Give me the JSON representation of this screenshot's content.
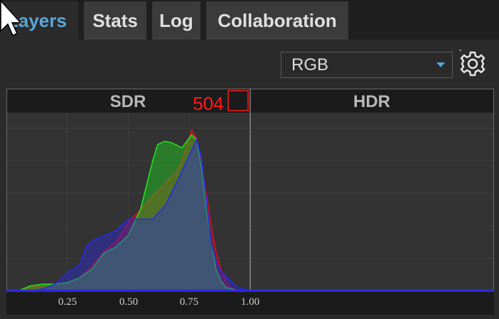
{
  "tabs": [
    {
      "label": "Layers",
      "active": true
    },
    {
      "label": "Stats",
      "active": false
    },
    {
      "label": "Log",
      "active": false
    },
    {
      "label": "Collaboration",
      "active": false
    }
  ],
  "channel_select": {
    "value": "RGB"
  },
  "icons": {
    "settings": "gear-icon",
    "cursor": "arrow-cursor-icon"
  },
  "colors": {
    "accent": "#5aa6d6",
    "red_channel": "#d01020",
    "green_channel": "#20e020",
    "blue_channel": "#2a2ae0",
    "sample_marker": "#ff1a1a"
  },
  "histogram": {
    "sdr_label": "SDR",
    "hdr_label": "HDR",
    "sample_value": "504",
    "x_ticks": [
      "0.25",
      "0.50",
      "0.75",
      "1.00"
    ]
  },
  "chart_data": {
    "type": "area",
    "xlabel": "",
    "ylabel": "",
    "xlim": [
      0,
      2
    ],
    "ylim": [
      0,
      1
    ],
    "grid": true,
    "x_ticks": [
      0.25,
      0.5,
      0.75,
      1.0
    ],
    "series": [
      {
        "color": "#d01020",
        "x": [
          0.0,
          0.05,
          0.1,
          0.15,
          0.2,
          0.25,
          0.3,
          0.35,
          0.4,
          0.45,
          0.5,
          0.55,
          0.6,
          0.65,
          0.7,
          0.72,
          0.74,
          0.76,
          0.78,
          0.8,
          0.82,
          0.84,
          0.86,
          0.88,
          0.9,
          0.92,
          0.95,
          1.0,
          1.05,
          2.0
        ],
        "y": [
          0.0,
          0.0,
          0.02,
          0.03,
          0.04,
          0.05,
          0.08,
          0.15,
          0.24,
          0.3,
          0.42,
          0.5,
          0.58,
          0.66,
          0.74,
          0.8,
          0.9,
          0.99,
          0.94,
          0.8,
          0.6,
          0.4,
          0.24,
          0.13,
          0.06,
          0.02,
          0.0,
          0.0,
          0.0,
          0.0
        ]
      },
      {
        "color": "#20e020",
        "x": [
          0.0,
          0.05,
          0.1,
          0.15,
          0.2,
          0.25,
          0.3,
          0.35,
          0.4,
          0.45,
          0.5,
          0.55,
          0.6,
          0.62,
          0.65,
          0.68,
          0.72,
          0.76,
          0.78,
          0.8,
          0.82,
          0.84,
          0.86,
          0.88,
          0.9,
          0.95,
          1.0,
          2.0
        ],
        "y": [
          0.0,
          0.0,
          0.03,
          0.04,
          0.04,
          0.05,
          0.08,
          0.13,
          0.23,
          0.27,
          0.34,
          0.5,
          0.8,
          0.9,
          0.92,
          0.91,
          0.88,
          0.96,
          0.93,
          0.75,
          0.5,
          0.3,
          0.13,
          0.06,
          0.02,
          0.0,
          0.0,
          0.0
        ]
      },
      {
        "color": "#2a2ae0",
        "x": [
          0.0,
          0.1,
          0.15,
          0.2,
          0.25,
          0.3,
          0.33,
          0.37,
          0.42,
          0.45,
          0.5,
          0.55,
          0.6,
          0.65,
          0.7,
          0.74,
          0.78,
          0.8,
          0.82,
          0.84,
          0.86,
          0.88,
          0.9,
          0.92,
          0.95,
          1.0,
          1.05,
          2.0
        ],
        "y": [
          0.0,
          0.0,
          0.01,
          0.04,
          0.11,
          0.16,
          0.28,
          0.32,
          0.35,
          0.37,
          0.44,
          0.44,
          0.44,
          0.52,
          0.67,
          0.8,
          0.93,
          0.82,
          0.56,
          0.3,
          0.18,
          0.12,
          0.09,
          0.06,
          0.02,
          0.0,
          0.0,
          0.0
        ]
      }
    ]
  }
}
